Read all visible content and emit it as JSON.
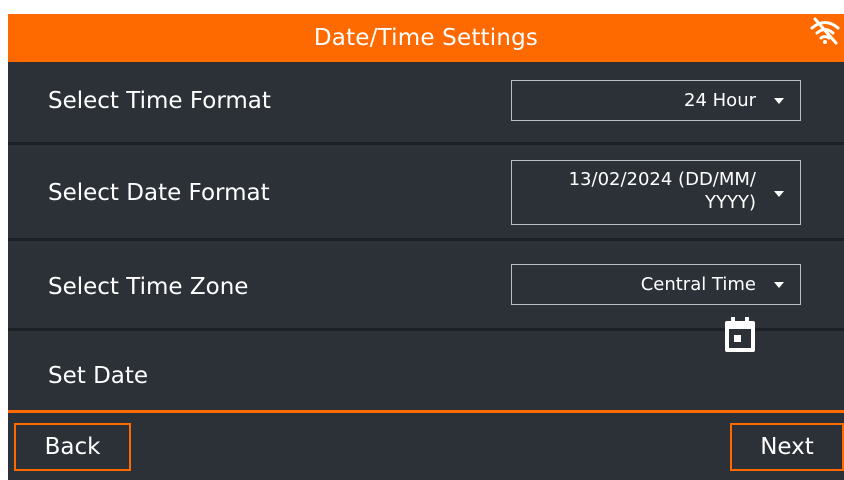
{
  "header": {
    "title": "Date/Time Settings",
    "wifi_icon": "wifi-off-icon"
  },
  "rows": [
    {
      "label": "Select Time Format",
      "value": "24 Hour"
    },
    {
      "label": "Select Date Format",
      "value_line1": "13/02/2024 (DD/MM/",
      "value_line2": "YYYY)"
    },
    {
      "label": "Select Time Zone",
      "value": "Central Time"
    },
    {
      "label": "Set Date",
      "icon": "calendar-icon"
    }
  ],
  "footer": {
    "back_label": "Back",
    "next_label": "Next"
  },
  "colors": {
    "accent": "#ff6a00",
    "panel": "#2b3137",
    "text": "#ffffff"
  }
}
